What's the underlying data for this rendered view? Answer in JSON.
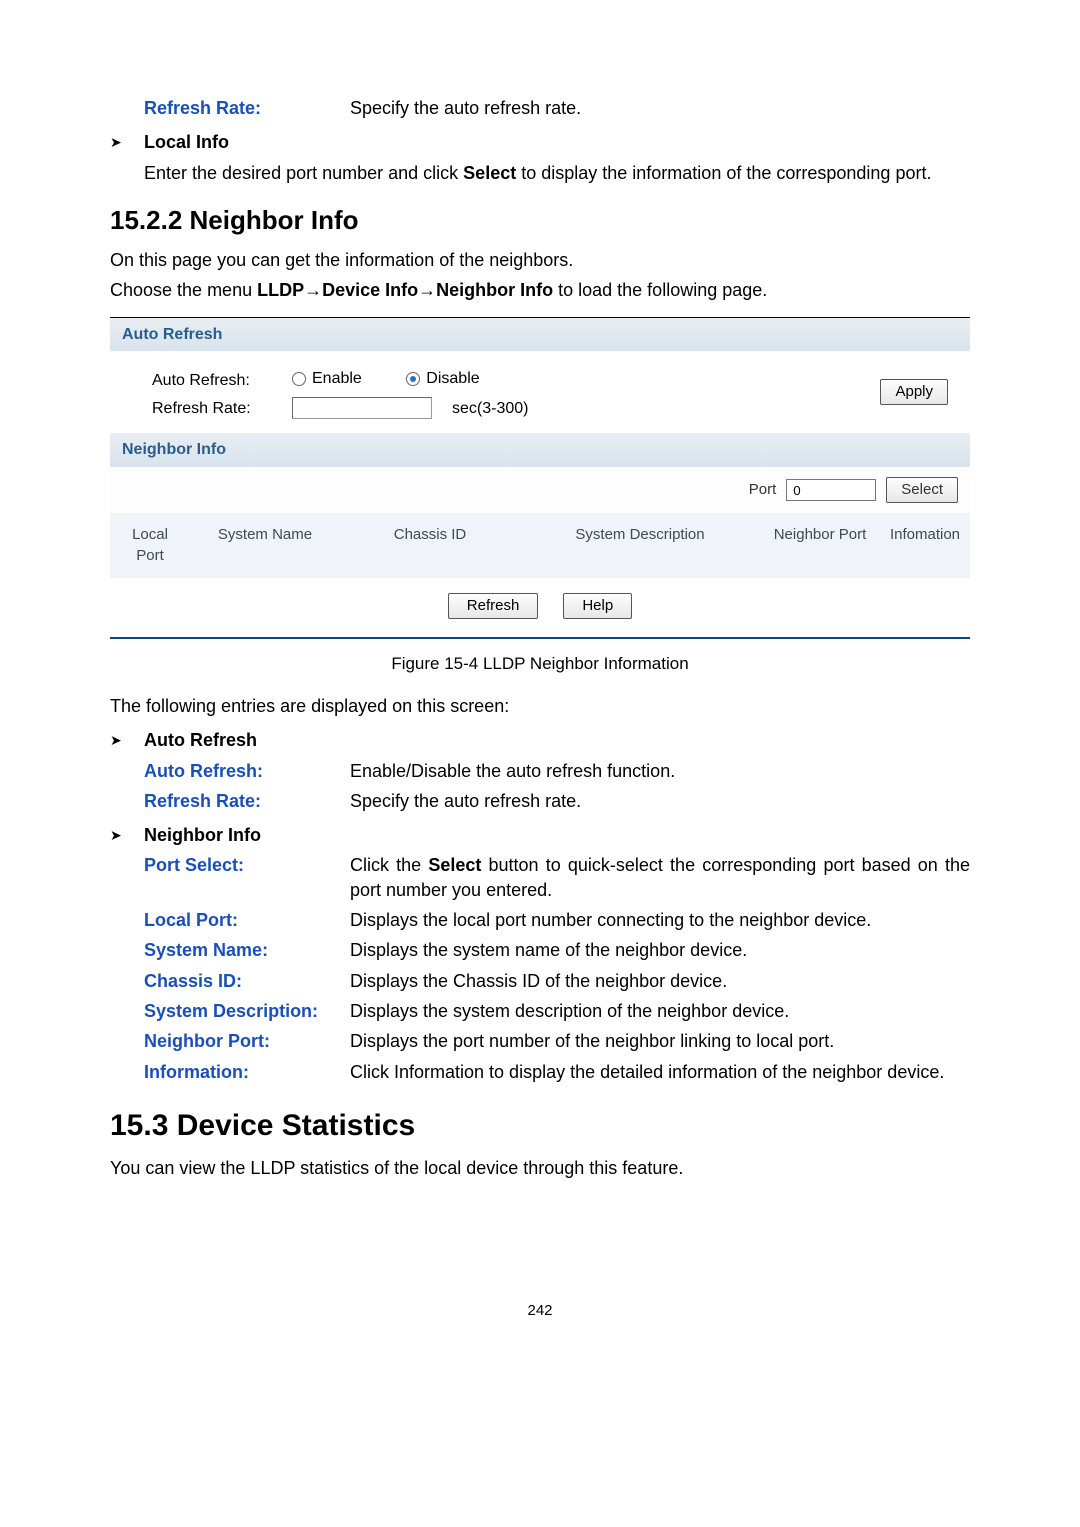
{
  "top_def": {
    "refresh_rate_term": "Refresh Rate:",
    "refresh_rate_desc": "Specify the auto refresh rate."
  },
  "local_info": {
    "heading": "Local Info",
    "body_pre": "Enter the desired port number and click ",
    "body_bold": "Select",
    "body_post": " to display the information of the corresponding port."
  },
  "sect_15_2_2": {
    "heading": "15.2.2  Neighbor Info",
    "p1": "On this page you can get the information of the neighbors.",
    "p2_pre": "Choose the menu ",
    "p2_bold": "LLDP→Device Info→Neighbor Info",
    "p2_post": " to load the following page."
  },
  "shot": {
    "auto_refresh_title": "Auto Refresh",
    "auto_refresh_label": "Auto Refresh:",
    "enable": "Enable",
    "disable": "Disable",
    "refresh_rate_label": "Refresh Rate:",
    "refresh_rate_hint": "sec(3-300)",
    "apply": "Apply",
    "neighbor_title": "Neighbor Info",
    "port_label": "Port",
    "port_value": "0",
    "select": "Select",
    "cols": {
      "local_port": "Local Port",
      "system_name": "System Name",
      "chassis_id": "Chassis ID",
      "system_desc": "System Description",
      "neighbor_port": "Neighbor Port",
      "information": "Infomation"
    },
    "refresh_btn": "Refresh",
    "help_btn": "Help"
  },
  "fig_caption": "Figure 15-4 LLDP Neighbor Information",
  "entries_intro": "The following entries are displayed on this screen:",
  "sect_auto_refresh": {
    "heading": "Auto Refresh",
    "rows": [
      {
        "term": "Auto Refresh:",
        "desc": "Enable/Disable the auto refresh function."
      },
      {
        "term": "Refresh Rate:",
        "desc": "Specify the auto refresh rate."
      }
    ]
  },
  "sect_neighbor_info": {
    "heading": "Neighbor Info",
    "port_select": {
      "term": "Port Select:",
      "pre": "Click the ",
      "bold": "Select",
      "post": " button to quick-select the corresponding port based on the port number you entered."
    },
    "rows": [
      {
        "term": "Local Port:",
        "desc": "Displays the local port number connecting to the neighbor device."
      },
      {
        "term": "System Name:",
        "desc": "Displays the system name of the neighbor device."
      },
      {
        "term": "Chassis ID:",
        "desc": "Displays the Chassis ID of the neighbor device."
      },
      {
        "term": "System Description:",
        "desc": "Displays the system description of the neighbor device."
      },
      {
        "term": "Neighbor Port:",
        "desc": "Displays the port number of the neighbor linking to local port."
      },
      {
        "term": "Information:",
        "desc": "Click Information to display the detailed information of the neighbor device."
      }
    ]
  },
  "sect_15_3": {
    "heading": "15.3 Device Statistics",
    "p1": "You can view the LLDP statistics of the local device through this feature."
  },
  "page_number": "242"
}
